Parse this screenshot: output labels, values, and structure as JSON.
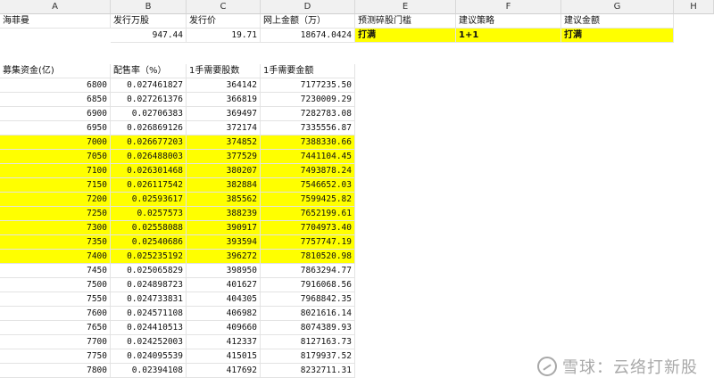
{
  "columns": [
    "A",
    "B",
    "C",
    "D",
    "E",
    "F",
    "G",
    "H"
  ],
  "header_row": {
    "A": "海菲曼",
    "B": "发行万股",
    "C": "发行价",
    "D": "网上金额（万）",
    "E": "预测碎股门槛",
    "F": "建议策略",
    "G": "建议金额"
  },
  "values_row": {
    "B": "947.44",
    "C": "19.71",
    "D": "18674.0424",
    "E": "打满",
    "F": "1+1",
    "G": "打满"
  },
  "table_header": {
    "A": "募集资金(亿)",
    "B": "配售率（%）",
    "C": "1手需要股数",
    "D": "1手需要金额"
  },
  "rows": [
    {
      "a": "6800",
      "b": "0.027461827",
      "c": "364142",
      "d": "7177235.50",
      "hl": false
    },
    {
      "a": "6850",
      "b": "0.027261376",
      "c": "366819",
      "d": "7230009.29",
      "hl": false
    },
    {
      "a": "6900",
      "b": "0.02706383",
      "c": "369497",
      "d": "7282783.08",
      "hl": false
    },
    {
      "a": "6950",
      "b": "0.026869126",
      "c": "372174",
      "d": "7335556.87",
      "hl": false
    },
    {
      "a": "7000",
      "b": "0.026677203",
      "c": "374852",
      "d": "7388330.66",
      "hl": true
    },
    {
      "a": "7050",
      "b": "0.026488003",
      "c": "377529",
      "d": "7441104.45",
      "hl": true
    },
    {
      "a": "7100",
      "b": "0.026301468",
      "c": "380207",
      "d": "7493878.24",
      "hl": true
    },
    {
      "a": "7150",
      "b": "0.026117542",
      "c": "382884",
      "d": "7546652.03",
      "hl": true
    },
    {
      "a": "7200",
      "b": "0.02593617",
      "c": "385562",
      "d": "7599425.82",
      "hl": true
    },
    {
      "a": "7250",
      "b": "0.0257573",
      "c": "388239",
      "d": "7652199.61",
      "hl": true
    },
    {
      "a": "7300",
      "b": "0.02558088",
      "c": "390917",
      "d": "7704973.40",
      "hl": true
    },
    {
      "a": "7350",
      "b": "0.02540686",
      "c": "393594",
      "d": "7757747.19",
      "hl": true
    },
    {
      "a": "7400",
      "b": "0.025235192",
      "c": "396272",
      "d": "7810520.98",
      "hl": true
    },
    {
      "a": "7450",
      "b": "0.025065829",
      "c": "398950",
      "d": "7863294.77",
      "hl": false
    },
    {
      "a": "7500",
      "b": "0.024898723",
      "c": "401627",
      "d": "7916068.56",
      "hl": false
    },
    {
      "a": "7550",
      "b": "0.024733831",
      "c": "404305",
      "d": "7968842.35",
      "hl": false
    },
    {
      "a": "7600",
      "b": "0.024571108",
      "c": "406982",
      "d": "8021616.14",
      "hl": false
    },
    {
      "a": "7650",
      "b": "0.024410513",
      "c": "409660",
      "d": "8074389.93",
      "hl": false
    },
    {
      "a": "7700",
      "b": "0.024252003",
      "c": "412337",
      "d": "8127163.73",
      "hl": false
    },
    {
      "a": "7750",
      "b": "0.024095539",
      "c": "415015",
      "d": "8179937.52",
      "hl": false
    },
    {
      "a": "7800",
      "b": "0.02394108",
      "c": "417692",
      "d": "8232711.31",
      "hl": false
    }
  ],
  "watermark": {
    "text": "雪球：云络打新股",
    "icon": "snowball-logo-icon"
  },
  "colors": {
    "highlight": "#ffff00",
    "header_bg": "#f1f1f1"
  }
}
